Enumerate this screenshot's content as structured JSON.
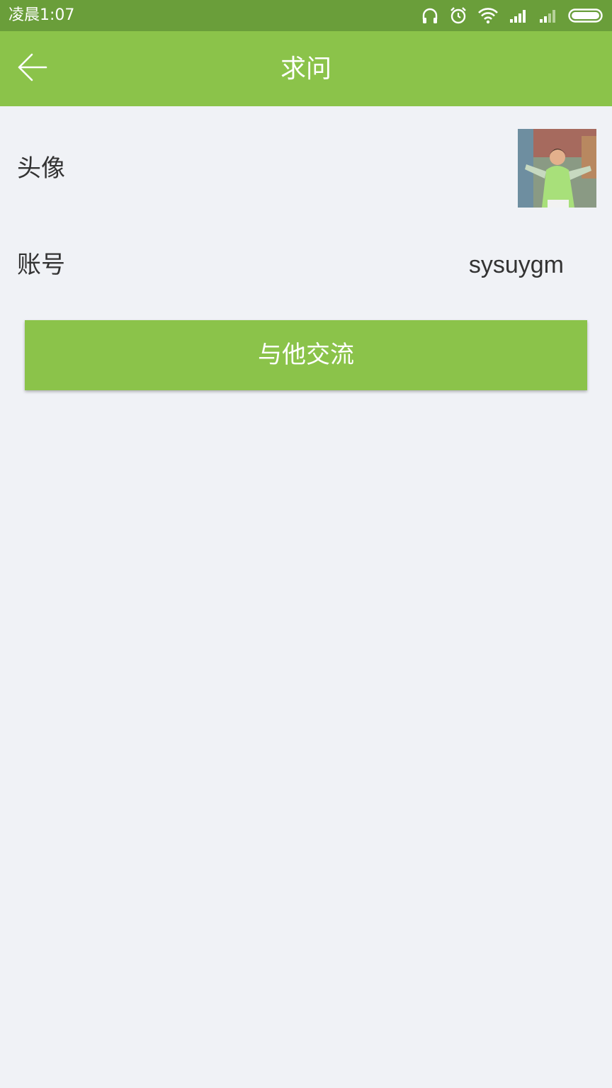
{
  "status_bar": {
    "time": "凌晨1:07",
    "icons": [
      "headphones-icon",
      "alarm-icon",
      "wifi-icon",
      "signal-icon",
      "signal-weak-icon",
      "battery-icon"
    ]
  },
  "header": {
    "title": "求问",
    "back_icon": "back-arrow-icon"
  },
  "profile": {
    "avatar_label": "头像",
    "account_label": "账号",
    "account_value": "sysuygm"
  },
  "actions": {
    "chat_label": "与他交流"
  },
  "colors": {
    "status_bar": "#6a9e3a",
    "accent": "#8bc34a",
    "background": "#f0f2f6",
    "text": "#333333"
  }
}
